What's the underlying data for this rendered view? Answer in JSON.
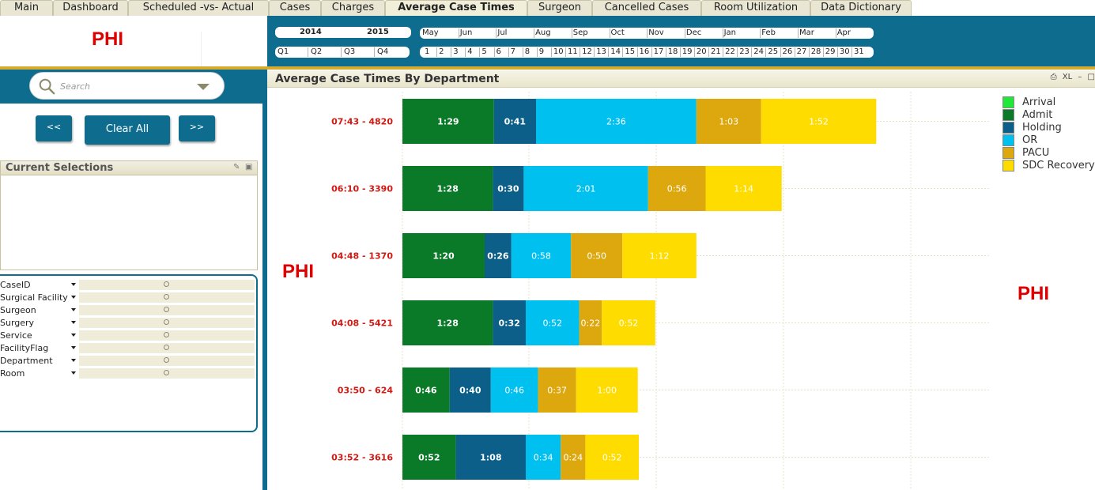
{
  "tabs": [
    {
      "label": "Main",
      "active": false
    },
    {
      "label": "Dashboard",
      "active": false
    },
    {
      "label": "Scheduled -vs- Actual",
      "active": false
    },
    {
      "label": "Cases",
      "active": false
    },
    {
      "label": "Charges",
      "active": false
    },
    {
      "label": "Average Case Times",
      "active": true
    },
    {
      "label": "Surgeon",
      "active": false
    },
    {
      "label": "Cancelled Cases",
      "active": false
    },
    {
      "label": "Room Utilization",
      "active": false
    },
    {
      "label": "Data Dictionary",
      "active": false
    }
  ],
  "header": {
    "phi_label": "PHI",
    "years": [
      "2014",
      "2015"
    ],
    "quarters": [
      "Q1",
      "Q2",
      "Q3",
      "Q4"
    ],
    "months": [
      "May",
      "Jun",
      "Jul",
      "Aug",
      "Sep",
      "Oct",
      "Nov",
      "Dec",
      "Jan",
      "Feb",
      "Mar",
      "Apr"
    ],
    "days": [
      "1",
      "2",
      "3",
      "4",
      "5",
      "6",
      "7",
      "8",
      "9",
      "10",
      "11",
      "12",
      "13",
      "14",
      "15",
      "16",
      "17",
      "18",
      "19",
      "20",
      "21",
      "22",
      "23",
      "24",
      "25",
      "26",
      "27",
      "28",
      "29",
      "30",
      "31"
    ]
  },
  "left": {
    "search_placeholder": "Search",
    "buttons": {
      "prev": "<<",
      "clear": "Clear All",
      "next": ">>"
    },
    "current_selections_title": "Current Selections",
    "fields": [
      "CaseID",
      "Surgical Facility",
      "Surgeon",
      "Surgery",
      "Service",
      "FacilityFlag",
      "Department",
      "Room"
    ]
  },
  "chart": {
    "title": "Average Case Times By Department",
    "toolbar": {
      "print": "⎙",
      "xl": "XL",
      "min": "–"
    },
    "phi_left": "PHI",
    "phi_right": "PHI"
  },
  "colors": {
    "Arrival": "#1fe838",
    "Admit": "#0a7a28",
    "Holding": "#0b5f88",
    "OR": "#00c0f0",
    "PACU": "#dca80e",
    "SDC Recovery": "#fedc00",
    "teal": "#0e6c8e",
    "gold": "#d4ab2f",
    "phi_red": "#e00000",
    "row_label_red": "#d21a14"
  },
  "chart_data": {
    "type": "bar",
    "orientation": "horizontal",
    "stacked": true,
    "title": "Average Case Times By Department",
    "legend": [
      "Arrival",
      "Admit",
      "Holding",
      "OR",
      "PACU",
      "SDC Recovery"
    ],
    "legend_position": "top-right",
    "grid": true,
    "categories": [
      "07:43 - 4820",
      "06:10 - 3390",
      "04:48 - 1370",
      "04:08 - 5421",
      "03:50 - 624",
      "03:52 - 3616"
    ],
    "series": [
      {
        "name": "Admit",
        "values": [
          89,
          88,
          80,
          88,
          46,
          52
        ],
        "labels": [
          "1:29",
          "1:28",
          "1:20",
          "1:28",
          "0:46",
          "0:52"
        ]
      },
      {
        "name": "Holding",
        "values": [
          41,
          30,
          26,
          32,
          40,
          68
        ],
        "labels": [
          "0:41",
          "0:30",
          "0:26",
          "0:32",
          "0:40",
          "1:08"
        ]
      },
      {
        "name": "OR",
        "values": [
          156,
          121,
          58,
          52,
          46,
          34
        ],
        "labels": [
          "2:36",
          "2:01",
          "0:58",
          "0:52",
          "0:46",
          "0:34"
        ]
      },
      {
        "name": "PACU",
        "values": [
          63,
          56,
          50,
          22,
          37,
          24
        ],
        "labels": [
          "1:03",
          "0:56",
          "0:50",
          "0:22",
          "0:37",
          "0:24"
        ]
      },
      {
        "name": "SDC Recovery",
        "values": [
          112,
          74,
          72,
          52,
          60,
          52
        ],
        "labels": [
          "1:52",
          "1:14",
          "1:12",
          "0:52",
          "1:00",
          "0:52"
        ]
      }
    ],
    "unit": "minutes"
  }
}
